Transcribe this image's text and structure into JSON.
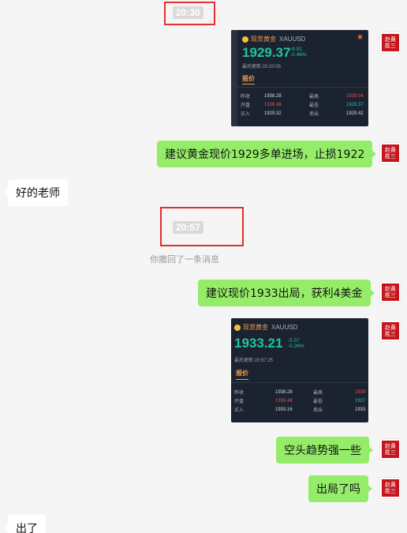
{
  "timestamps": {
    "t1": "20:30",
    "t2": "20:57"
  },
  "recall_notice": "你撤回了一条消息",
  "avatar_seal": "赵黄胜三",
  "cards": [
    {
      "name": "现货黄金",
      "code": "XAUUSD",
      "price": "1929.37",
      "change": "-8.91",
      "change_pct": "-0.46%",
      "updated": "最后更新:20:20:05",
      "tab": "报价",
      "rows": [
        {
          "l1": "昨收",
          "v1": "1938.28",
          "l2": "最高",
          "v2": "1939.04"
        },
        {
          "l1": "开盘",
          "v1": "1938.48",
          "l2": "最低",
          "v2": "1928.37"
        },
        {
          "l1": "买入",
          "v1": "1929.32",
          "l2": "卖出",
          "v2": "1929.42"
        }
      ]
    },
    {
      "name": "现货黄金",
      "code": "XAUUSD",
      "price": "1933.21",
      "change": "-5.07",
      "change_pct": "-0.26%",
      "updated": "最后更新:20:57:25",
      "tab": "报价",
      "rows": [
        {
          "l1": "昨收",
          "v1": "1938.28",
          "l2": "最高",
          "v2": "1939"
        },
        {
          "l1": "开盘",
          "v1": "1938.48",
          "l2": "最低",
          "v2": "1927"
        },
        {
          "l1": "买入",
          "v1": "1933.16",
          "l2": "卖出",
          "v2": "1933"
        }
      ]
    }
  ],
  "messages": {
    "m1": "建议黄金现价1929多单进场，止损1922",
    "m2": "好的老师",
    "m3": "建议现价1933出局，获利4美金",
    "m4": "空头趋势强一些",
    "m5": "出局了吗",
    "m6": "出了"
  }
}
